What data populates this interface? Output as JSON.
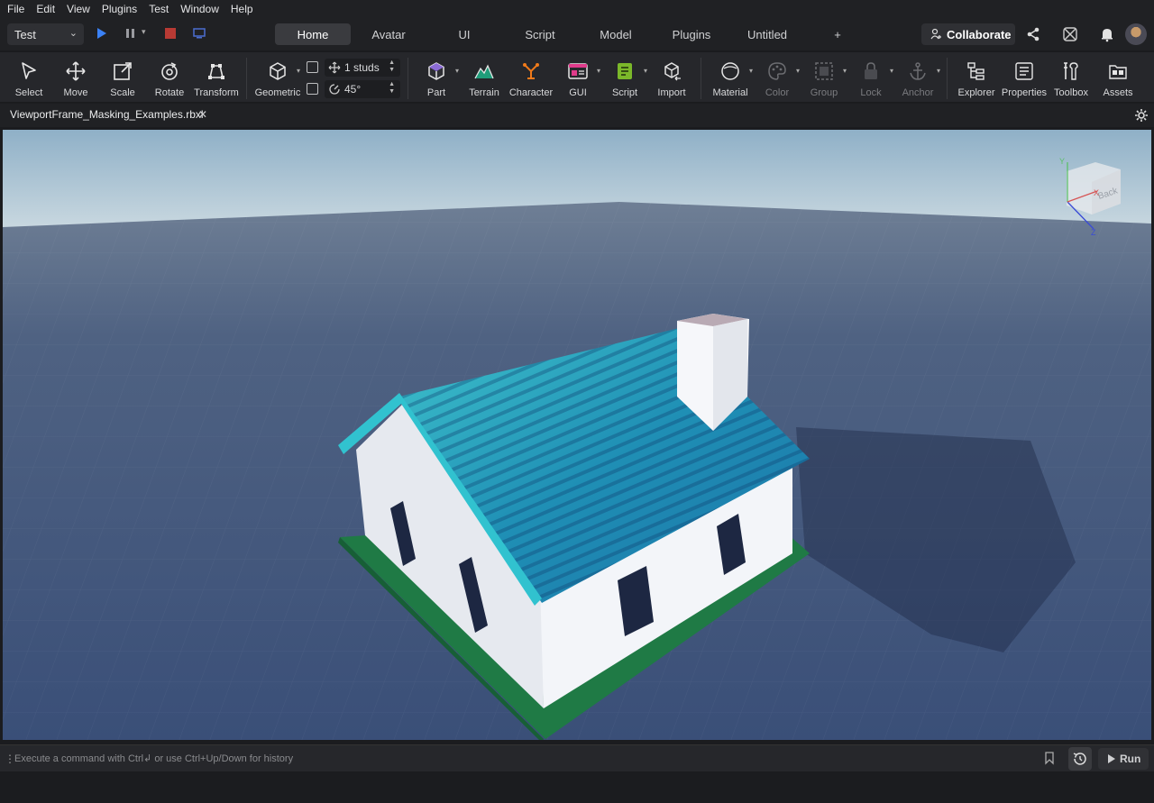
{
  "menu": [
    "File",
    "Edit",
    "View",
    "Plugins",
    "Test",
    "Window",
    "Help"
  ],
  "mode_select": {
    "value": "Test"
  },
  "ribbon_tabs": [
    {
      "label": "Home",
      "active": true
    },
    {
      "label": "Avatar"
    },
    {
      "label": "UI"
    },
    {
      "label": "Script"
    },
    {
      "label": "Model"
    },
    {
      "label": "Plugins"
    },
    {
      "label": "Untitled"
    },
    {
      "label": "+"
    }
  ],
  "collaborate_label": "Collaborate",
  "toolbar": {
    "select": "Select",
    "move": "Move",
    "scale": "Scale",
    "rotate": "Rotate",
    "transform": "Transform",
    "geometric": "Geometric",
    "move_snap": "1 studs",
    "rotate_snap": "45°",
    "part": "Part",
    "terrain": "Terrain",
    "character": "Character",
    "gui": "GUI",
    "script": "Script",
    "import": "Import",
    "material": "Material",
    "color": "Color",
    "group": "Group",
    "lock": "Lock",
    "anchor": "Anchor",
    "explorer": "Explorer",
    "properties": "Properties",
    "toolbox": "Toolbox",
    "assets": "Assets"
  },
  "file_tab": {
    "name": "ViewportFrame_Masking_Examples.rbxl"
  },
  "view_cube": {
    "face_label": "Back",
    "axes": [
      "Y",
      "X",
      "Z"
    ]
  },
  "command_bar": {
    "placeholder": "Execute a command with Ctrl↲ or use Ctrl+Up/Down for history",
    "run_label": "Run"
  },
  "colors": {
    "accent_play": "#3b82f6",
    "stop": "#c0392b",
    "roof": "#2ab3c0",
    "walls": "#e9ecf2",
    "base": "#1f8a4c"
  }
}
